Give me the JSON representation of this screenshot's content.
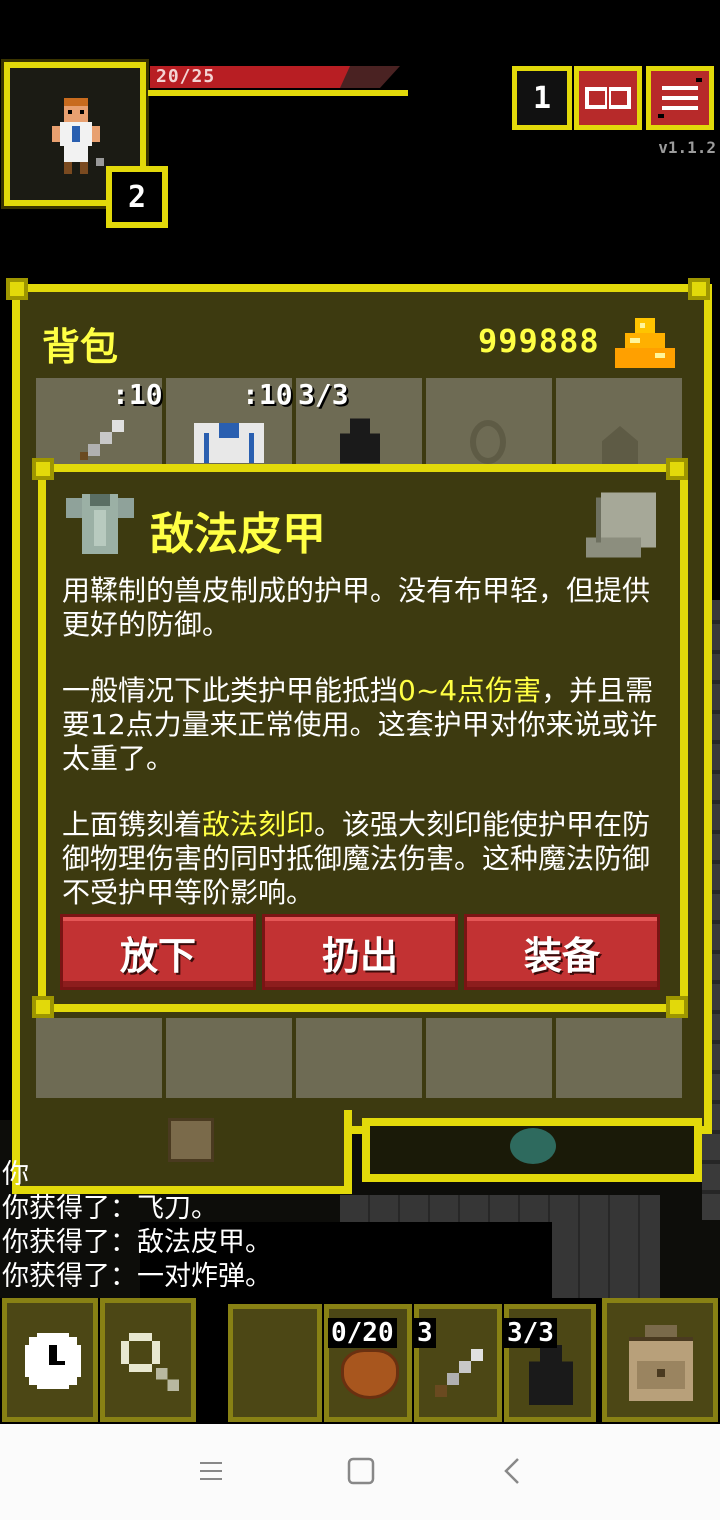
{
  "status": {
    "hp_text": "20/25",
    "hp_fraction": 0.8,
    "level": "2",
    "depth": "1",
    "version": "v1.1.2"
  },
  "backpack": {
    "title": "背包",
    "gold": "999888",
    "slot_counts": {
      "weapon": ":10",
      "armor": ":10",
      "ring": "3/3"
    }
  },
  "item_info": {
    "title": "敌法皮甲",
    "para1": "用鞣制的兽皮制成的护甲。没有布甲轻，但提供更好的防御。",
    "para2_a": "一般情况下此类护甲能抵挡",
    "para2_hl": "0~4点伤害",
    "para2_b": "，并且需要12点力量来正常使用。这套护甲对你来说或许太重了。",
    "para3_a": "上面镌刻着",
    "para3_hl": "敌法刻印",
    "para3_b": "。该强大刻印能使护甲在防御物理伤害的同时抵御魔法伤害。这种魔法防御不受护甲等阶影响。",
    "buttons": {
      "drop": "放下",
      "throw": "扔出",
      "equip": "装备"
    }
  },
  "log": {
    "line0": "你",
    "line1": "你获得了：飞刀。",
    "line2": "你获得了：敌法皮甲。",
    "line3": "你获得了：一对炸弹。"
  },
  "toolbar": {
    "quickslot1": "0/20",
    "quickslot2": "3",
    "quickslot3": "3/3"
  },
  "colors": {
    "frame": "#e2d90a",
    "panel": "#3d3a10",
    "accent_text": "#ffff44",
    "button": "#c23233"
  },
  "icons": [
    "hero-portrait",
    "journal-icon",
    "menu-icon",
    "gold-pile-icon",
    "sword-icon",
    "armor-icon",
    "scroll-icon",
    "clock-icon",
    "search-icon",
    "backpack-icon"
  ]
}
